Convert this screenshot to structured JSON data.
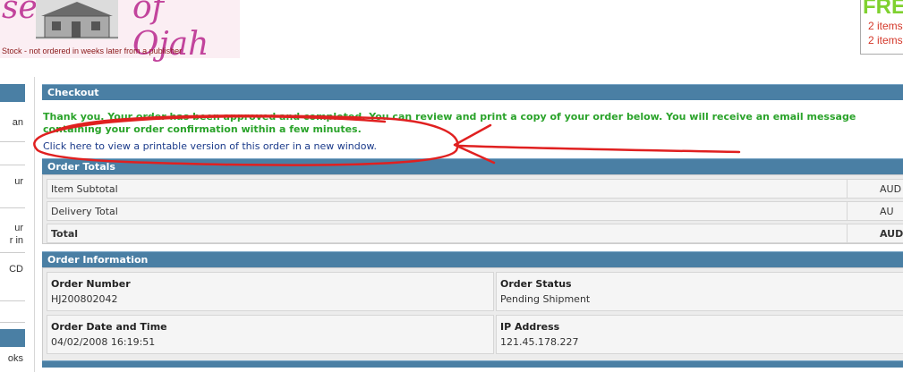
{
  "header": {
    "logo_left": "se",
    "logo_right": "of Ojah",
    "tagline": "Stock - not ordered in weeks later from a publisher",
    "cart_free": "FRE",
    "cart_items_1": "2 items",
    "cart_items_2": "2 items"
  },
  "sidebar": {
    "items": [
      "an",
      "ur",
      "ur\nr in",
      "CD",
      "oks"
    ]
  },
  "checkout": {
    "title": "Checkout",
    "message": "Thank you. Your order has been approved and completed. You can review and print a copy of your order below. You will receive an email message containing your order confirmation within a few minutes.",
    "print_link": "Click here to view a printable version of this order in a new window."
  },
  "order_totals": {
    "title": "Order Totals",
    "rows": [
      {
        "label": "Item Subtotal",
        "value": "AUD"
      },
      {
        "label": "Delivery Total",
        "value": "AU"
      },
      {
        "label": "Total",
        "value": "AUD"
      }
    ]
  },
  "order_information": {
    "title": "Order Information",
    "order_number_label": "Order Number",
    "order_number": "HJ200802042",
    "order_status_label": "Order Status",
    "order_status": "Pending Shipment",
    "date_label": "Order Date and Time",
    "date_value": "04/02/2008 16:19:51",
    "ip_label": "IP Address",
    "ip_value": "121.45.178.227"
  },
  "colors": {
    "bar": "#4a7fa4",
    "success_text": "#2aa32a",
    "link": "#1a3a8a",
    "annotation": "#e02020",
    "logo": "#c2449c"
  },
  "icons": [
    "house-logo-icon"
  ]
}
